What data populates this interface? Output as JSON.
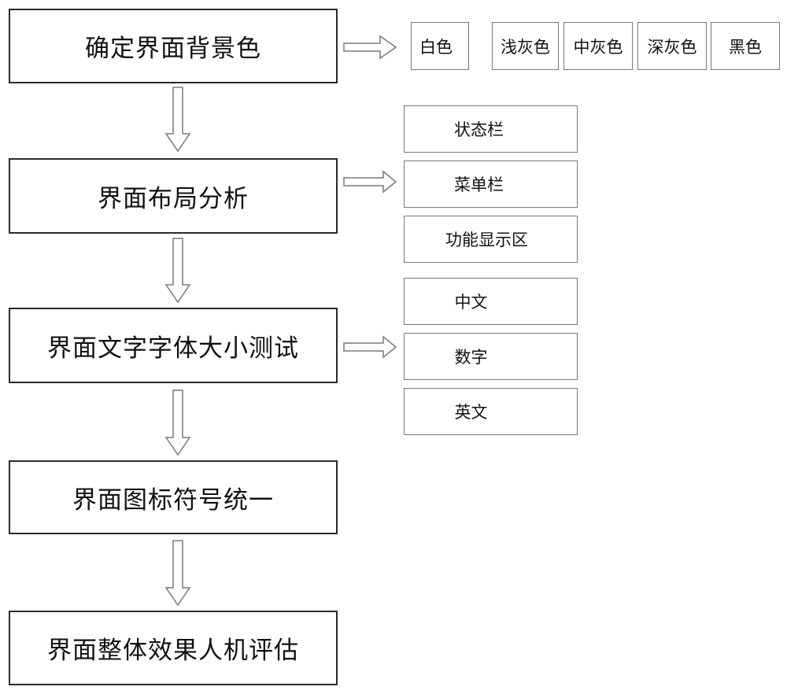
{
  "diagram": {
    "type": "flowchart",
    "steps": [
      {
        "label": "确定界面背景色",
        "options": [
          "白色",
          "浅灰色",
          "中灰色",
          "深灰色",
          "黑色"
        ]
      },
      {
        "label": "界面布局分析",
        "options": [
          "状态栏",
          "菜单栏",
          "功能显示区"
        ]
      },
      {
        "label": "界面文字字体大小测试",
        "options": [
          "中文",
          "数字",
          "英文"
        ]
      },
      {
        "label": "界面图标符号统一",
        "options": []
      },
      {
        "label": "界面整体效果人机评估",
        "options": []
      }
    ],
    "arrows": {
      "down_icon": "hollow-down-arrow",
      "right_icon": "hollow-right-arrow"
    }
  }
}
